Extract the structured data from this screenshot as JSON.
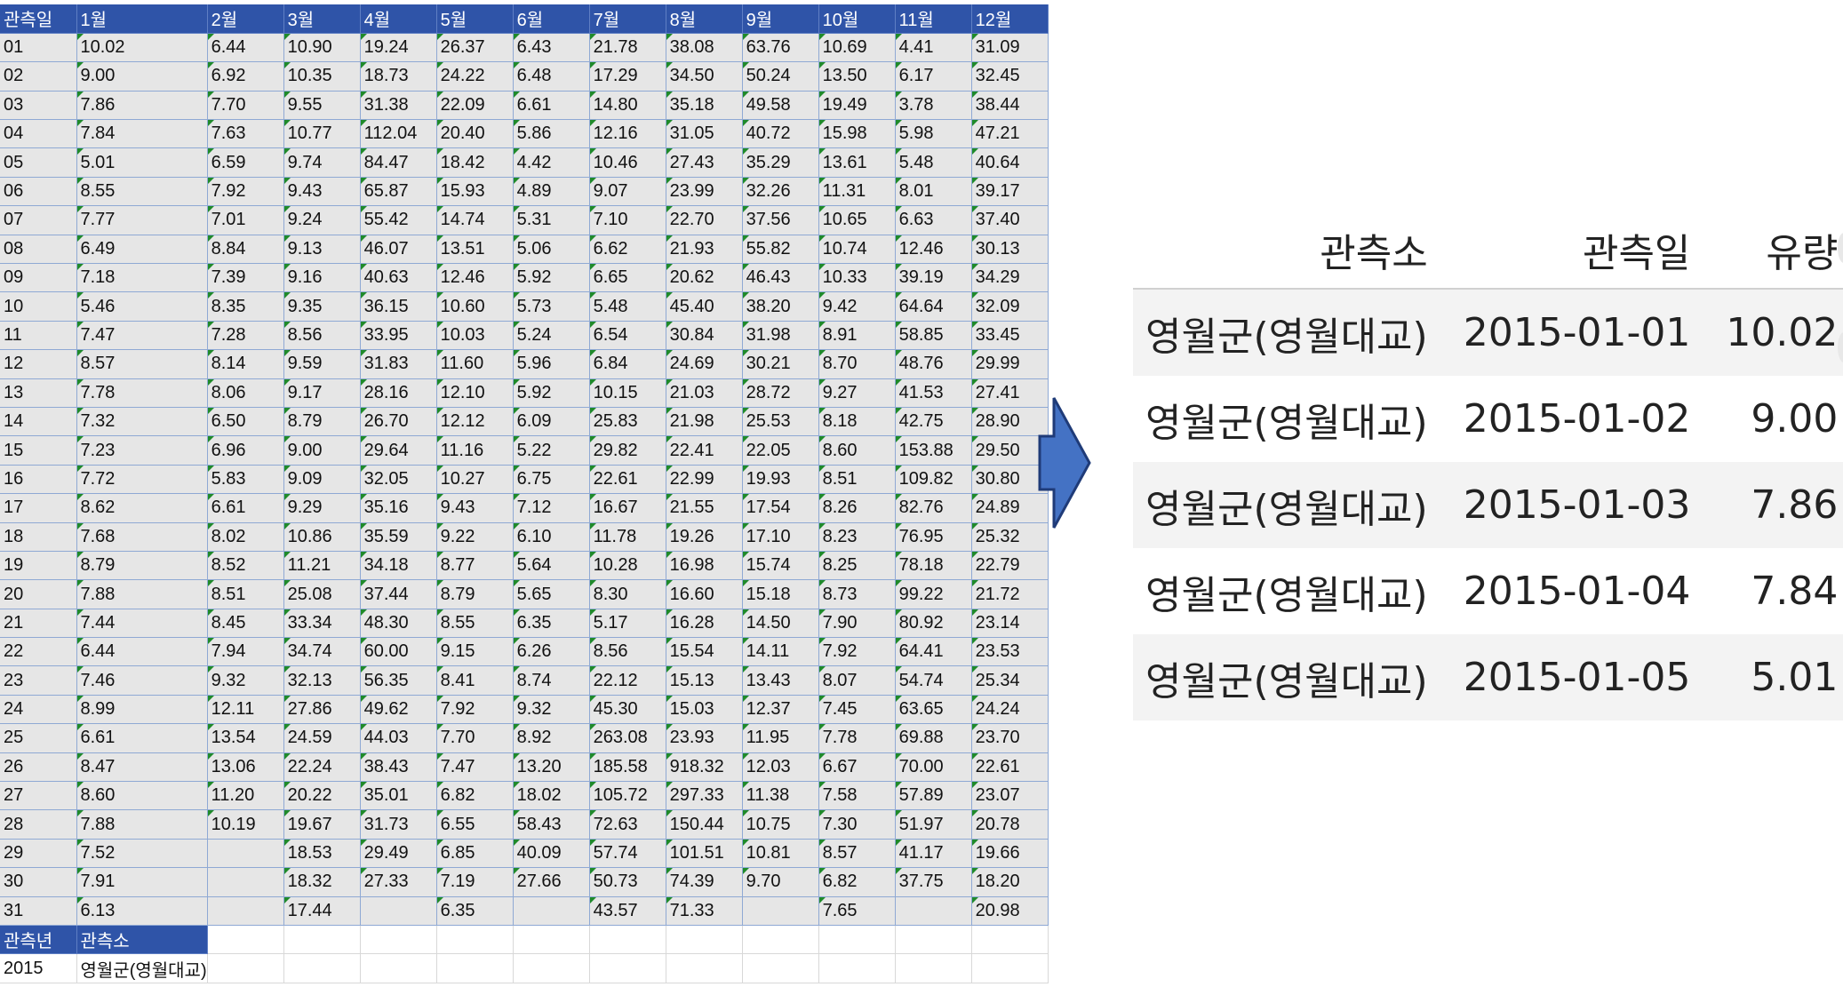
{
  "sheet": {
    "header": [
      "관측일",
      "1월",
      "2월",
      "3월",
      "4월",
      "5월",
      "6월",
      "7월",
      "8월",
      "9월",
      "10월",
      "11월",
      "12월"
    ],
    "rows": [
      [
        "01",
        "10.02",
        "6.44",
        "10.90",
        "19.24",
        "26.37",
        "6.43",
        "21.78",
        "38.08",
        "63.76",
        "10.69",
        "4.41",
        "31.09"
      ],
      [
        "02",
        "9.00",
        "6.92",
        "10.35",
        "18.73",
        "24.22",
        "6.48",
        "17.29",
        "34.50",
        "50.24",
        "13.50",
        "6.17",
        "32.45"
      ],
      [
        "03",
        "7.86",
        "7.70",
        "9.55",
        "31.38",
        "22.09",
        "6.61",
        "14.80",
        "35.18",
        "49.58",
        "19.49",
        "3.78",
        "38.44"
      ],
      [
        "04",
        "7.84",
        "7.63",
        "10.77",
        "112.04",
        "20.40",
        "5.86",
        "12.16",
        "31.05",
        "40.72",
        "15.98",
        "5.98",
        "47.21"
      ],
      [
        "05",
        "5.01",
        "6.59",
        "9.74",
        "84.47",
        "18.42",
        "4.42",
        "10.46",
        "27.43",
        "35.29",
        "13.61",
        "5.48",
        "40.64"
      ],
      [
        "06",
        "8.55",
        "7.92",
        "9.43",
        "65.87",
        "15.93",
        "4.89",
        "9.07",
        "23.99",
        "32.26",
        "11.31",
        "8.01",
        "39.17"
      ],
      [
        "07",
        "7.77",
        "7.01",
        "9.24",
        "55.42",
        "14.74",
        "5.31",
        "7.10",
        "22.70",
        "37.56",
        "10.65",
        "6.63",
        "37.40"
      ],
      [
        "08",
        "6.49",
        "8.84",
        "9.13",
        "46.07",
        "13.51",
        "5.06",
        "6.62",
        "21.93",
        "55.82",
        "10.74",
        "12.46",
        "30.13"
      ],
      [
        "09",
        "7.18",
        "7.39",
        "9.16",
        "40.63",
        "12.46",
        "5.92",
        "6.65",
        "20.62",
        "46.43",
        "10.33",
        "39.19",
        "34.29"
      ],
      [
        "10",
        "5.46",
        "8.35",
        "9.35",
        "36.15",
        "10.60",
        "5.73",
        "5.48",
        "45.40",
        "38.20",
        "9.42",
        "64.64",
        "32.09"
      ],
      [
        "11",
        "7.47",
        "7.28",
        "8.56",
        "33.95",
        "10.03",
        "5.24",
        "6.54",
        "30.84",
        "31.98",
        "8.91",
        "58.85",
        "33.45"
      ],
      [
        "12",
        "8.57",
        "8.14",
        "9.59",
        "31.83",
        "11.60",
        "5.96",
        "6.84",
        "24.69",
        "30.21",
        "8.70",
        "48.76",
        "29.99"
      ],
      [
        "13",
        "7.78",
        "8.06",
        "9.17",
        "28.16",
        "12.10",
        "5.92",
        "10.15",
        "21.03",
        "28.72",
        "9.27",
        "41.53",
        "27.41"
      ],
      [
        "14",
        "7.32",
        "6.50",
        "8.79",
        "26.70",
        "12.12",
        "6.09",
        "25.83",
        "21.98",
        "25.53",
        "8.18",
        "42.75",
        "28.90"
      ],
      [
        "15",
        "7.23",
        "6.96",
        "9.00",
        "29.64",
        "11.16",
        "5.22",
        "29.82",
        "22.41",
        "22.05",
        "8.60",
        "153.88",
        "29.50"
      ],
      [
        "16",
        "7.72",
        "5.83",
        "9.09",
        "32.05",
        "10.27",
        "6.75",
        "22.61",
        "22.99",
        "19.93",
        "8.51",
        "109.82",
        "30.80"
      ],
      [
        "17",
        "8.62",
        "6.61",
        "9.29",
        "35.16",
        "9.43",
        "7.12",
        "16.67",
        "21.55",
        "17.54",
        "8.26",
        "82.76",
        "24.89"
      ],
      [
        "18",
        "7.68",
        "8.02",
        "10.86",
        "35.59",
        "9.22",
        "6.10",
        "11.78",
        "19.26",
        "17.10",
        "8.23",
        "76.95",
        "25.32"
      ],
      [
        "19",
        "8.79",
        "8.52",
        "11.21",
        "34.18",
        "8.77",
        "5.64",
        "10.28",
        "16.98",
        "15.74",
        "8.25",
        "78.18",
        "22.79"
      ],
      [
        "20",
        "7.88",
        "8.51",
        "25.08",
        "37.44",
        "8.79",
        "5.65",
        "8.30",
        "16.60",
        "15.18",
        "8.73",
        "99.22",
        "21.72"
      ],
      [
        "21",
        "7.44",
        "8.45",
        "33.34",
        "48.30",
        "8.55",
        "6.35",
        "5.17",
        "16.28",
        "14.50",
        "7.90",
        "80.92",
        "23.14"
      ],
      [
        "22",
        "6.44",
        "7.94",
        "34.74",
        "60.00",
        "9.15",
        "6.26",
        "8.56",
        "15.54",
        "14.11",
        "7.92",
        "64.41",
        "23.53"
      ],
      [
        "23",
        "7.46",
        "9.32",
        "32.13",
        "56.35",
        "8.41",
        "8.74",
        "22.12",
        "15.13",
        "13.43",
        "8.07",
        "54.74",
        "25.34"
      ],
      [
        "24",
        "8.99",
        "12.11",
        "27.86",
        "49.62",
        "7.92",
        "9.32",
        "45.30",
        "15.03",
        "12.37",
        "7.45",
        "63.65",
        "24.24"
      ],
      [
        "25",
        "6.61",
        "13.54",
        "24.59",
        "44.03",
        "7.70",
        "8.92",
        "263.08",
        "23.93",
        "11.95",
        "7.78",
        "69.88",
        "23.70"
      ],
      [
        "26",
        "8.47",
        "13.06",
        "22.24",
        "38.43",
        "7.47",
        "13.20",
        "185.58",
        "918.32",
        "12.03",
        "6.67",
        "70.00",
        "22.61"
      ],
      [
        "27",
        "8.60",
        "11.20",
        "20.22",
        "35.01",
        "6.82",
        "18.02",
        "105.72",
        "297.33",
        "11.38",
        "7.58",
        "57.89",
        "23.07"
      ],
      [
        "28",
        "7.88",
        "10.19",
        "19.67",
        "31.73",
        "6.55",
        "58.43",
        "72.63",
        "150.44",
        "10.75",
        "7.30",
        "51.97",
        "20.78"
      ],
      [
        "29",
        "7.52",
        "",
        "18.53",
        "29.49",
        "6.85",
        "40.09",
        "57.74",
        "101.51",
        "10.81",
        "8.57",
        "41.17",
        "19.66"
      ],
      [
        "30",
        "7.91",
        "",
        "18.32",
        "27.33",
        "7.19",
        "27.66",
        "50.73",
        "74.39",
        "9.70",
        "6.82",
        "37.75",
        "18.20"
      ],
      [
        "31",
        "6.13",
        "",
        "17.44",
        "",
        "6.35",
        "",
        "43.57",
        "71.33",
        "",
        "7.65",
        "",
        "20.98"
      ]
    ],
    "meta_header": [
      "관측년",
      "관측소"
    ],
    "meta_values": [
      "2015",
      "영월군(영월대교)"
    ]
  },
  "arrow": {
    "icon": "right-arrow-icon",
    "color": "#4472c4"
  },
  "result": {
    "columns": [
      "관측소",
      "관측일",
      "유량"
    ],
    "rows": [
      [
        "영월군(영월대교)",
        "2015-01-01",
        "10.02"
      ],
      [
        "영월군(영월대교)",
        "2015-01-02",
        "9.00"
      ],
      [
        "영월군(영월대교)",
        "2015-01-03",
        "7.86"
      ],
      [
        "영월군(영월대교)",
        "2015-01-04",
        "7.84"
      ],
      [
        "영월군(영월대교)",
        "2015-01-05",
        "5.01"
      ]
    ]
  }
}
